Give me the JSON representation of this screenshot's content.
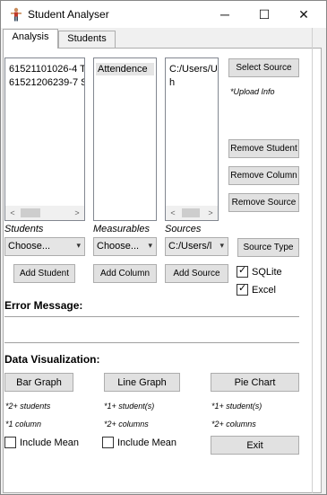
{
  "window": {
    "title": "Student Analyser",
    "controls": {
      "minimize": "─",
      "maximize": "☐",
      "close": "✕"
    }
  },
  "tabs": [
    {
      "label": "Analysis",
      "active": true
    },
    {
      "label": "Students",
      "active": false
    }
  ],
  "lists": {
    "students": {
      "items": [
        "61521101026-4 T",
        "61521206239-7 S"
      ]
    },
    "measurables": {
      "items": [
        "Attendence"
      ]
    },
    "sources": {
      "items": [
        "C:/Users/U",
        "h"
      ]
    }
  },
  "buttons": {
    "select_source": "Select Source",
    "remove_student": "Remove Student",
    "remove_column": "Remove Column",
    "remove_source": "Remove Source",
    "source_type": "Source Type",
    "add_student": "Add Student",
    "add_column": "Add Column",
    "add_source": "Add Source",
    "bar_graph": "Bar Graph",
    "line_graph": "Line Graph",
    "pie_chart": "Pie Chart",
    "exit": "Exit"
  },
  "upload_info": "*Upload Info",
  "labels": {
    "students": "Students",
    "measurables": "Measurables",
    "sources": "Sources"
  },
  "combos": {
    "students": "Choose...",
    "measurables": "Choose...",
    "sources": "C:/Users/l"
  },
  "checks": {
    "sqlite": {
      "label": "SQLite",
      "checked": true
    },
    "excel": {
      "label": "Excel",
      "checked": true
    }
  },
  "error_heading": "Error Message:",
  "viz_heading": "Data Visualization:",
  "notes": {
    "bar_1": "*2+ students",
    "bar_2": "*1 column",
    "line_1": "*1+ student(s)",
    "line_2": "*2+ columns",
    "pie_1": "*1+ student(s)",
    "pie_2": "*2+ columns"
  },
  "include_mean": {
    "bar": {
      "label": "Include Mean",
      "checked": false
    },
    "line": {
      "label": "Include Mean",
      "checked": false
    }
  },
  "scroll": {
    "left_arrow": "<",
    "right_arrow": ">",
    "dropdown_arrow": "▾",
    "tick": "✓"
  }
}
